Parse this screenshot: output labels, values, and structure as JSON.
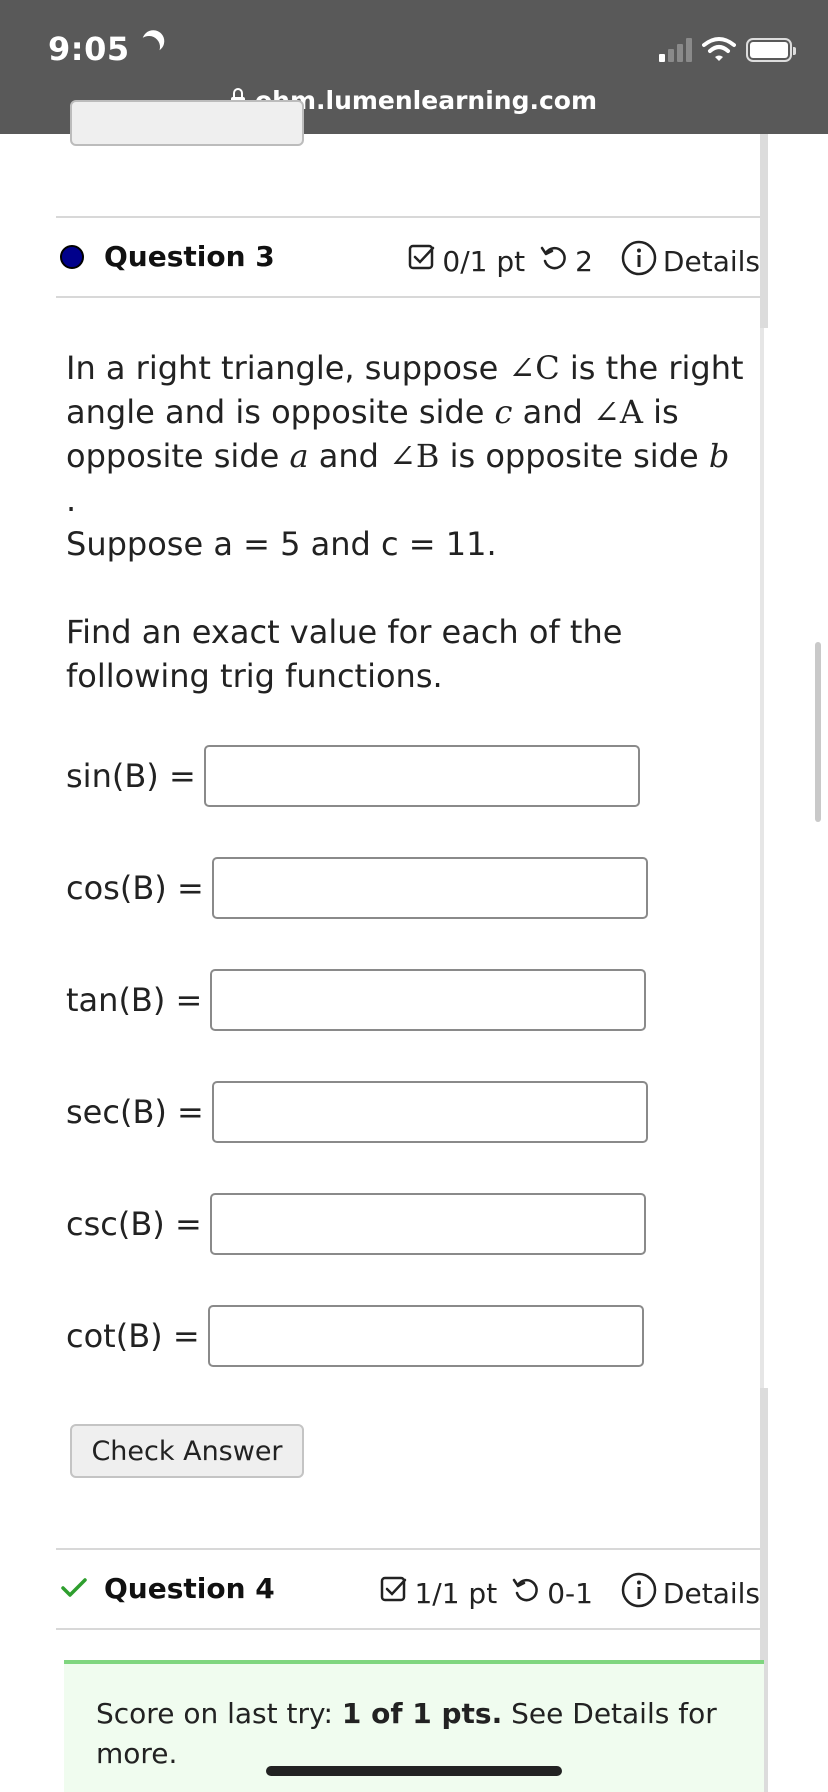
{
  "status_bar": {
    "time": "9:05",
    "url": "ohm.lumenlearning.com"
  },
  "question3": {
    "title": "Question 3",
    "points": "0/1 pt",
    "retries": "2",
    "details": "Details",
    "status_color": "#00008b",
    "text1_a": "In a right triangle, suppose ",
    "angle_C": "∠C",
    "text1_b": " is the right angle and is opposite side ",
    "side_c": "c",
    "text1_c": " and ",
    "angle_A": "∠A",
    "text1_d": " is opposite side ",
    "side_a": "a",
    "text1_e": " and ",
    "angle_B": "∠B",
    "text1_f": " is opposite side ",
    "side_b": "b",
    "text1_g": " .",
    "given": "Suppose a = 5 and c = 11.",
    "instruction": "Find an exact value for each of the following trig functions.",
    "functions": [
      {
        "label": "sin(B) =",
        "value": ""
      },
      {
        "label": "cos(B) =",
        "value": ""
      },
      {
        "label": "tan(B) =",
        "value": ""
      },
      {
        "label": "sec(B) =",
        "value": ""
      },
      {
        "label": "csc(B) =",
        "value": ""
      },
      {
        "label": "cot(B) =",
        "value": ""
      }
    ],
    "check_button": "Check Answer"
  },
  "question4": {
    "title": "Question 4",
    "points": "1/1 pt",
    "retries": "0-1",
    "details": "Details",
    "status_color": "#2e9e2e",
    "score_prefix": "Score on last try: ",
    "score_bold": "1 of 1 pts.",
    "score_suffix": " See Details for more."
  }
}
